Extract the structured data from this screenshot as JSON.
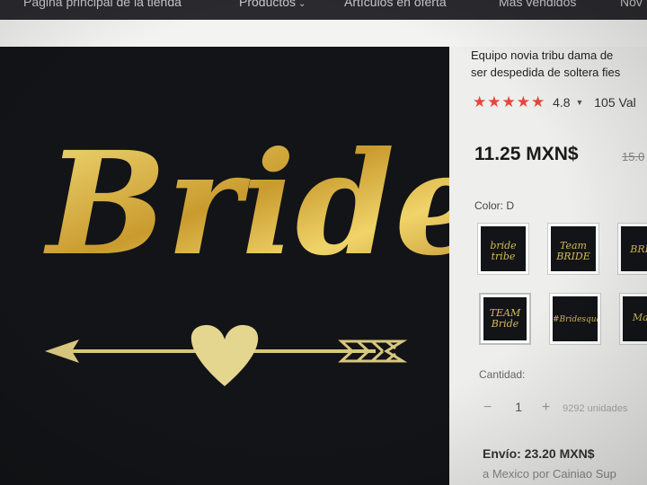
{
  "nav": {
    "home": "Página principal de la tienda",
    "products": "Productos",
    "offers": "Artículos en oferta",
    "best_sellers": "Más vendidos",
    "new": "Nov"
  },
  "product": {
    "image_text": "Bride",
    "title_line1": "Equipo novia tribu dama de",
    "title_line2": "ser despedida de soltera fies",
    "stars": "★★★★★",
    "rating": "4.8",
    "reviews": "105 Val",
    "price": "11.25 MXN$",
    "old_price": "15.0",
    "color_label": "Color: D",
    "swatches": [
      {
        "text": "bride tribe"
      },
      {
        "text": "Team BRIDE"
      },
      {
        "text": "BRID"
      },
      {
        "text": "TEAM Bride"
      },
      {
        "text": "#Bridesquad"
      },
      {
        "text": "Ma..."
      }
    ],
    "quantity_label": "Cantidad:",
    "quantity_minus": "−",
    "quantity_value": "1",
    "quantity_plus": "+",
    "available": "9292 unidades",
    "shipping": "Envío: 23.20 MXN$",
    "shipping_dest": "a Mexico por Cainiao Sup"
  },
  "colors": {
    "accent_star": "#e8453c",
    "gold": "#d6b95a",
    "image_bg": "#121417"
  }
}
